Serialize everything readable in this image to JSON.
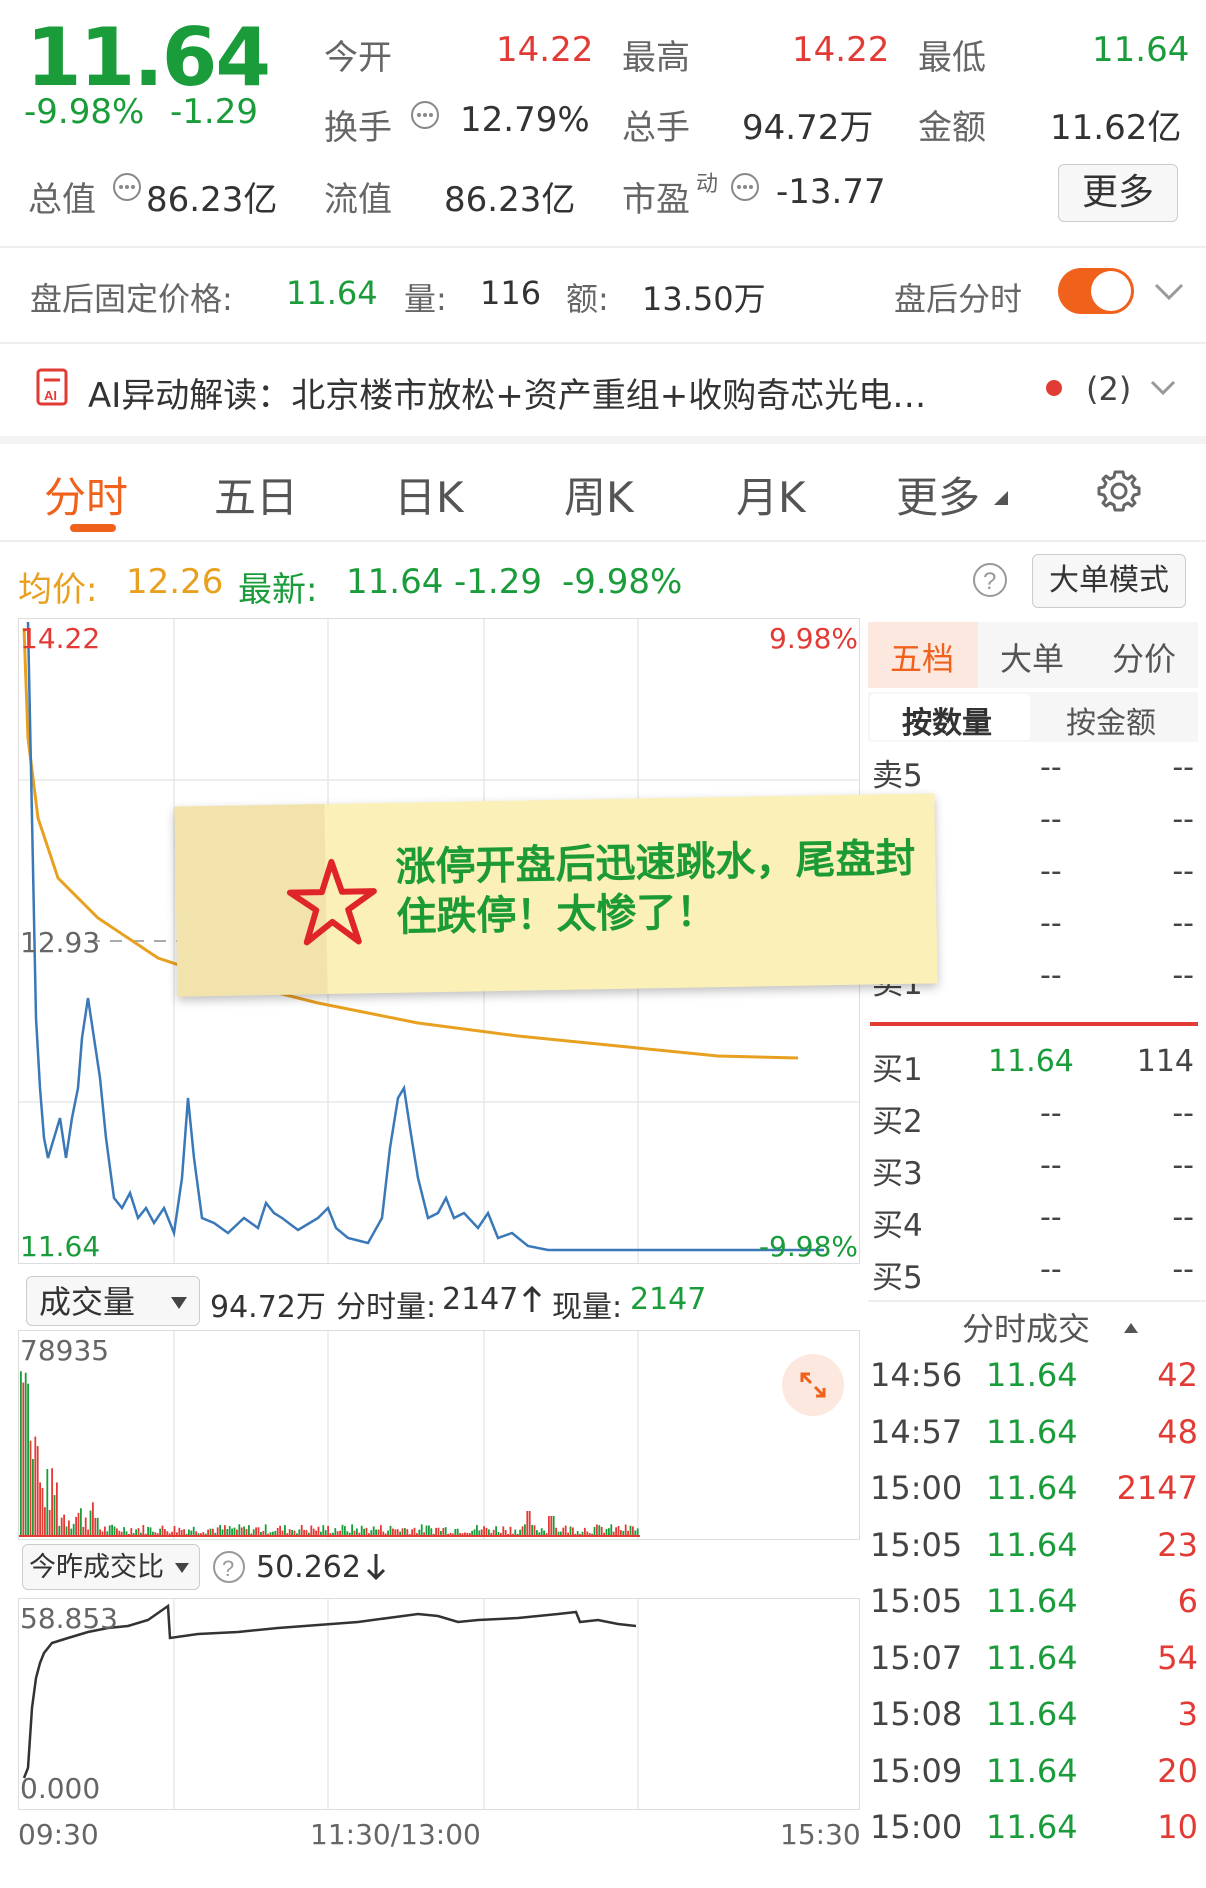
{
  "quote": {
    "last_price": "11.64",
    "change_pct": "-9.98%",
    "change": "-1.29",
    "open_label": "今开",
    "open": "14.22",
    "high_label": "最高",
    "high": "14.22",
    "low_label": "最低",
    "low": "11.64",
    "turnover_label": "换手",
    "turnover": "12.79%",
    "volume_label": "总手",
    "volume": "94.72万",
    "amount_label": "金额",
    "amount": "11.62亿",
    "mktcap_label": "总值",
    "mktcap": "86.23亿",
    "float_label": "流值",
    "float": "86.23亿",
    "pe_label": "市盈",
    "pe_sup": "动",
    "pe": "-13.77",
    "more_label": "更多"
  },
  "after_hours": {
    "price_label": "盘后固定价格:",
    "price": "11.64",
    "vol_label": "量:",
    "vol": "116",
    "amt_label": "额:",
    "amt": "13.50万",
    "toggle_label": "盘后分时"
  },
  "ai": {
    "text": "AI异动解读：北京楼市放松+资产重组+收购奇芯光电…",
    "count": "(2)"
  },
  "tabs": [
    "分时",
    "五日",
    "日K",
    "周K",
    "月K",
    "更多"
  ],
  "summary": {
    "avg_label": "均价:",
    "avg": "12.26",
    "latest_label": "最新:",
    "latest": "11.64",
    "chg": "-1.29",
    "chg_pct": "-9.98%",
    "big_order_mode": "大单模式"
  },
  "price_chart": {
    "top_left": "14.22",
    "top_right": "9.98%",
    "mid_left": "12.93",
    "bottom_left": "11.64",
    "bottom_right": "-9.98%"
  },
  "volume_bar": {
    "selector": "成交量",
    "total": "94.72万",
    "tick_label": "分时量:",
    "tick": "2147",
    "now_label": "现量:",
    "now": "2147",
    "max": "78935"
  },
  "ratio_bar": {
    "selector": "今昨成交比",
    "value": "50.262",
    "max": "58.853",
    "min": "0.000"
  },
  "time_axis": [
    "09:30",
    "11:30/13:00",
    "15:30"
  ],
  "order_book": {
    "tabs": [
      "五档",
      "大单",
      "分价"
    ],
    "subtabs": [
      "按数量",
      "按金额"
    ],
    "sells": [
      {
        "label": "卖5",
        "price": "--",
        "qty": "--"
      },
      {
        "label": "",
        "price": "--",
        "qty": "--"
      },
      {
        "label": "",
        "price": "--",
        "qty": "--"
      },
      {
        "label": "",
        "price": "--",
        "qty": "--"
      },
      {
        "label": "卖1",
        "price": "--",
        "qty": "--"
      }
    ],
    "buys": [
      {
        "label": "买1",
        "price": "11.64",
        "qty": "114"
      },
      {
        "label": "买2",
        "price": "--",
        "qty": "--"
      },
      {
        "label": "买3",
        "price": "--",
        "qty": "--"
      },
      {
        "label": "买4",
        "price": "--",
        "qty": "--"
      },
      {
        "label": "买5",
        "price": "--",
        "qty": "--"
      }
    ]
  },
  "ticks": {
    "title": "分时成交",
    "rows": [
      {
        "time": "14:56",
        "price": "11.64",
        "qty": "42"
      },
      {
        "time": "14:57",
        "price": "11.64",
        "qty": "48"
      },
      {
        "time": "15:00",
        "price": "11.64",
        "qty": "2147"
      },
      {
        "time": "15:05",
        "price": "11.64",
        "qty": "23"
      },
      {
        "time": "15:05",
        "price": "11.64",
        "qty": "6"
      },
      {
        "time": "15:07",
        "price": "11.64",
        "qty": "54"
      },
      {
        "time": "15:08",
        "price": "11.64",
        "qty": "3"
      },
      {
        "time": "15:09",
        "price": "11.64",
        "qty": "20"
      },
      {
        "time": "15:00",
        "price": "11.64",
        "qty": "10"
      }
    ]
  },
  "sticky_note": "涨停开盘后迅速跳水，尾盘封住跌停！太惨了！",
  "colors": {
    "up": "#e23b36",
    "down": "#1a9c3a",
    "accent": "#f0611c",
    "avg": "#e8a020",
    "line": "#3a78b8"
  }
}
